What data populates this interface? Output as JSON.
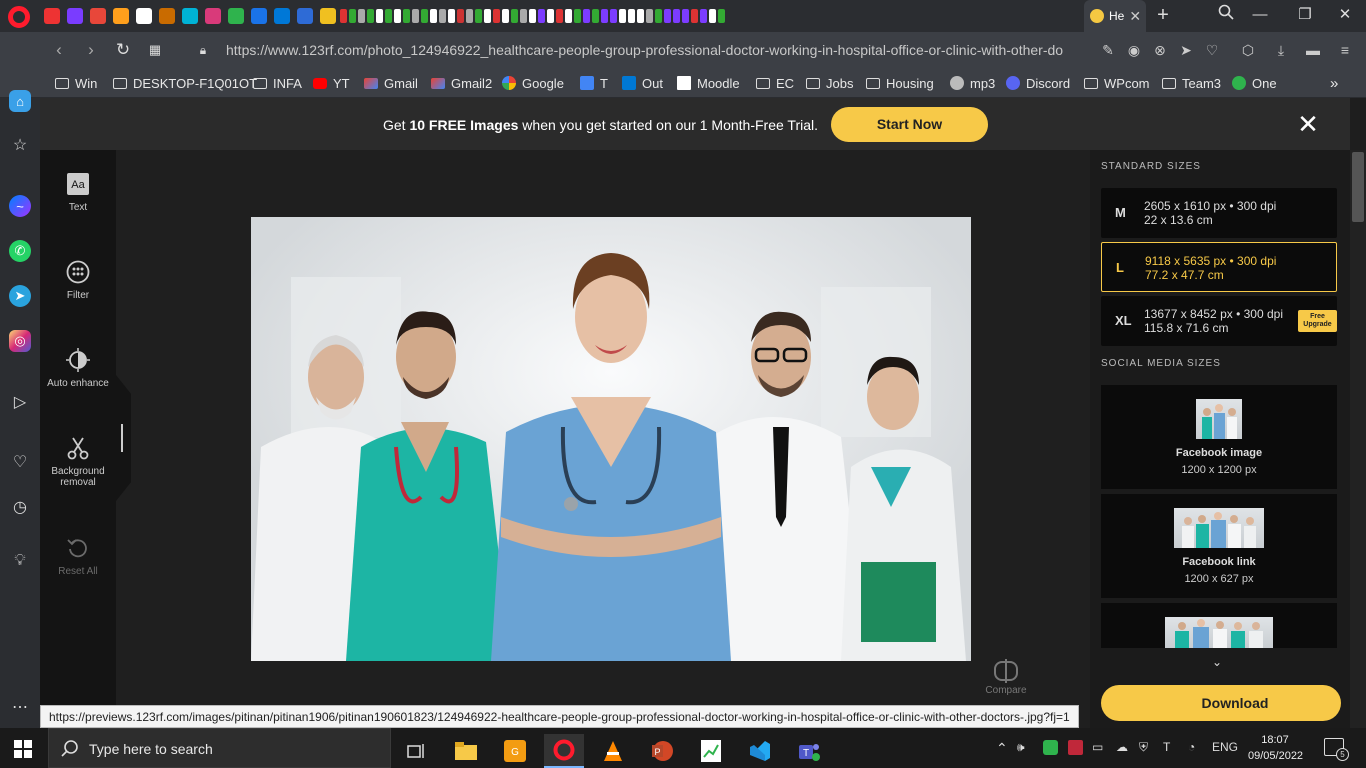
{
  "browser": {
    "active_tab_title": "He",
    "url": "https://www.123rf.com/photo_124946922_healthcare-people-group-professional-doctor-working-in-hospital-office-or-clinic-with-other-do",
    "tab_favicon_colors": [
      "#e33",
      "#7a3cff",
      "#e8473a",
      "#ff9f1c",
      "#ffffff",
      "#c96b00",
      "#00b3d6",
      "#d93a7a",
      "#2fb34d",
      "#1a73e8",
      "#0078d7",
      "#2e6bd6",
      "#f0c020"
    ],
    "mini_tab_colors": [
      "#d33",
      "#3a3",
      "#aaa",
      "#3a3",
      "#fff",
      "#3a3",
      "#fff",
      "#3a3",
      "#aaa",
      "#3a3",
      "#fff",
      "#aaa",
      "#fff",
      "#c33",
      "#aaa",
      "#3a3",
      "#fff",
      "#d33",
      "#fff",
      "#3a3",
      "#aaa",
      "#fff",
      "#7c3cff",
      "#fff",
      "#d33",
      "#fff",
      "#3a3",
      "#7c3cff",
      "#3a3",
      "#7c3cff",
      "#7c3cff",
      "#fff",
      "#fff",
      "#fff",
      "#aaa",
      "#3a3",
      "#7c3cff",
      "#7c3cff",
      "#7c3cff",
      "#d33",
      "#7c3cff",
      "#fff",
      "#3a3"
    ]
  },
  "bookmarks": [
    {
      "label": "Win",
      "icon": "folder-icon"
    },
    {
      "label": "DESKTOP-F1Q01OT",
      "icon": "folder-icon"
    },
    {
      "label": "INFA",
      "icon": "folder-icon"
    },
    {
      "label": "YT",
      "icon": "youtube-icon"
    },
    {
      "label": "Gmail",
      "icon": "gmail-icon"
    },
    {
      "label": "Gmail2",
      "icon": "gmail-icon"
    },
    {
      "label": "Google",
      "icon": "google-icon"
    },
    {
      "label": "T",
      "icon": "translate-icon"
    },
    {
      "label": "Out",
      "icon": "outlook-icon"
    },
    {
      "label": "Moodle",
      "icon": "moodle-icon"
    },
    {
      "label": "EC",
      "icon": "folder-icon"
    },
    {
      "label": "Jobs",
      "icon": "folder-icon"
    },
    {
      "label": "Housing",
      "icon": "folder-icon"
    },
    {
      "label": "mp3",
      "icon": "music-icon"
    },
    {
      "label": "Discord",
      "icon": "discord-icon"
    },
    {
      "label": "WPcom",
      "icon": "folder-icon"
    },
    {
      "label": "Team3",
      "icon": "folder-icon"
    },
    {
      "label": "One",
      "icon": "green-dot-icon"
    }
  ],
  "promo": {
    "text_pre": "Get ",
    "text_bold": "10 FREE Images",
    "text_post": " when you get started on our 1 Month-Free Trial.",
    "button": "Start Now"
  },
  "tools": [
    {
      "label": "Text",
      "icon": "text-icon"
    },
    {
      "label": "Filter",
      "icon": "filter-icon"
    },
    {
      "label": "Auto enhance",
      "icon": "auto-enhance-icon"
    },
    {
      "label": "Background removal",
      "icon": "scissors-icon"
    },
    {
      "label": "Reset All",
      "icon": "reset-icon"
    }
  ],
  "compare_label": "Compare",
  "panel": {
    "standard_heading": "STANDARD SIZES",
    "social_heading": "SOCIAL MEDIA SIZES",
    "sizes": [
      {
        "letter": "M",
        "px": "2605 x 1610 px • 300 dpi",
        "cm": "22 x 13.6 cm",
        "selected": false
      },
      {
        "letter": "L",
        "px": "9118 x 5635 px • 300 dpi",
        "cm": "77.2 x 47.7 cm",
        "selected": true
      },
      {
        "letter": "XL",
        "px": "13677 x 8452 px • 300 dpi",
        "cm": "115.8 x 71.6 cm",
        "selected": false
      }
    ],
    "free_upgrade": "Free Upgrade",
    "social": [
      {
        "name": "Facebook image",
        "dim": "1200 x 1200 px"
      },
      {
        "name": "Facebook link",
        "dim": "1200 x 627 px"
      }
    ],
    "download": "Download",
    "accent": "#f7c948"
  },
  "status_url": "https://previews.123rf.com/images/pitinan/pitinan1906/pitinan190601823/124946922-healthcare-people-group-professional-doctor-working-in-hospital-office-or-clinic-with-other-doctors-.jpg?fj=1",
  "taskbar": {
    "search_placeholder": "Type here to search",
    "language": "ENG",
    "time": "18:07",
    "date": "09/05/2022",
    "notifications": "5"
  }
}
